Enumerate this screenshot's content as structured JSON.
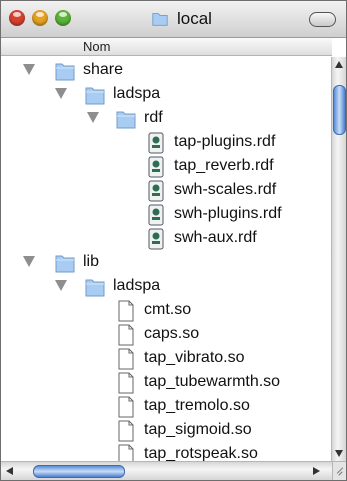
{
  "window": {
    "title": "local"
  },
  "columns": {
    "name_header": "Nom"
  },
  "rows": [
    {
      "label": "share",
      "kind": "folder",
      "expanded": true
    },
    {
      "label": "ladspa",
      "kind": "folder",
      "expanded": true
    },
    {
      "label": "rdf",
      "kind": "folder",
      "expanded": true
    },
    {
      "label": "tap-plugins.rdf",
      "kind": "rdf-document"
    },
    {
      "label": "tap_reverb.rdf",
      "kind": "rdf-document"
    },
    {
      "label": "swh-scales.rdf",
      "kind": "rdf-document"
    },
    {
      "label": "swh-plugins.rdf",
      "kind": "rdf-document"
    },
    {
      "label": "swh-aux.rdf",
      "kind": "rdf-document"
    },
    {
      "label": "lib",
      "kind": "folder",
      "expanded": true
    },
    {
      "label": "ladspa",
      "kind": "folder",
      "expanded": true
    },
    {
      "label": "cmt.so",
      "kind": "document"
    },
    {
      "label": "caps.so",
      "kind": "document"
    },
    {
      "label": "tap_vibrato.so",
      "kind": "document"
    },
    {
      "label": "tap_tubewarmth.so",
      "kind": "document"
    },
    {
      "label": "tap_tremolo.so",
      "kind": "document"
    },
    {
      "label": "tap_sigmoid.so",
      "kind": "document"
    },
    {
      "label": "tap_rotspeak.so",
      "kind": "document"
    }
  ],
  "colors": {
    "folder": "#a9cdf2",
    "scroll_thumb": "#5a8ed8",
    "close": "#d8412f",
    "minimize": "#e5a223",
    "zoom": "#5cb43a"
  },
  "icons": {
    "folder": "folder-icon",
    "document": "document-icon",
    "rdf_document": "rdf-document-icon"
  }
}
